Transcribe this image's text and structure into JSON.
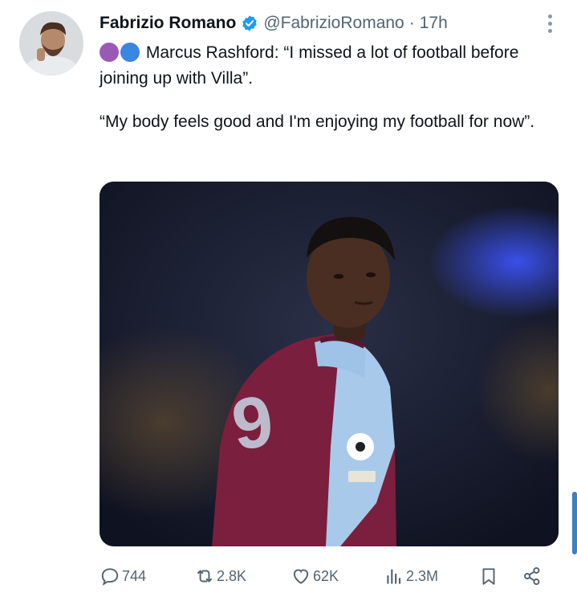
{
  "tweet": {
    "author_name": "Fabrizio Romano",
    "handle": "@FabrizioRomano",
    "separator": "·",
    "time": "17h",
    "verified_icon": "verified-badge-icon",
    "emoji_colors": [
      "#9b59b6",
      "#3a86e0"
    ],
    "line1": "Marcus Rashford: “I missed a lot of football before joining up with Villa”.",
    "line2": "“My body feels good and I'm enjoying my football for now”."
  },
  "actions": {
    "replies": "744",
    "reposts": "2.8K",
    "likes": "62K",
    "views": "2.3M"
  },
  "colors": {
    "text": "#0f1419",
    "muted": "#536471",
    "verified": "#1d9bf0",
    "claret": "#7a1f3d",
    "sky": "#9fc3e6"
  }
}
